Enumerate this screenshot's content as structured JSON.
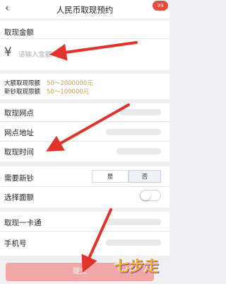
{
  "header": {
    "back_icon": "chevron-left-icon",
    "title": "人民币取现预约",
    "badge": "99"
  },
  "amount": {
    "section_label": "取现金额",
    "currency_symbol": "¥",
    "placeholder": "请输入金额"
  },
  "limits": [
    {
      "label": "大额取现限额",
      "value": "50～2000000元"
    },
    {
      "label": "新钞取现限额",
      "value": "50～100000元"
    }
  ],
  "form": {
    "branch_label": "取现网点",
    "address_label": "网点地址",
    "time_label": "取现时间",
    "new_notes_label": "需要新钞",
    "yes_label": "是",
    "no_label": "否",
    "denomination_label": "选择面额",
    "card_label": "取现一卡通",
    "phone_label": "手机号"
  },
  "submit_label": "提交",
  "watermark": "七步走",
  "colors": {
    "accent": "#e64b3c",
    "limit_value": "#c9a25a",
    "submit_bg": "#f1a7a7",
    "arrow": "#e0332b"
  }
}
